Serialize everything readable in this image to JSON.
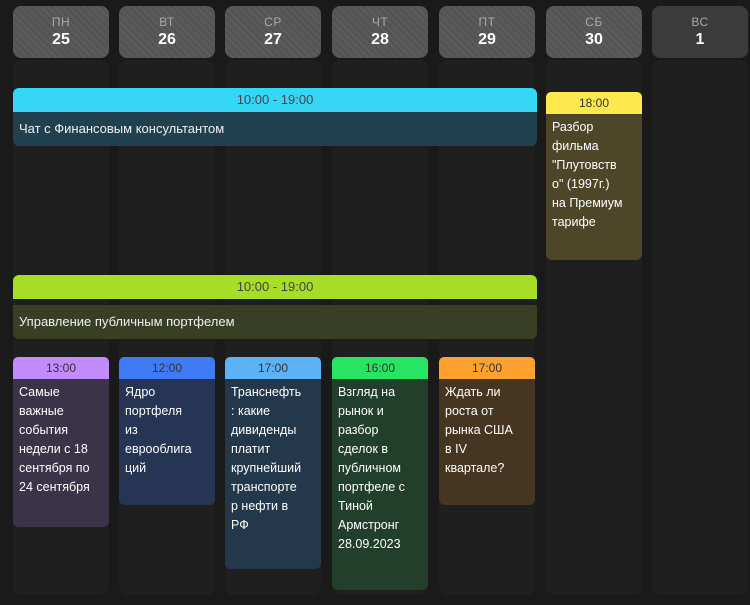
{
  "days": [
    {
      "dow": "ПН",
      "num": "25"
    },
    {
      "dow": "ВТ",
      "num": "26"
    },
    {
      "dow": "СР",
      "num": "27"
    },
    {
      "dow": "ЧТ",
      "num": "28"
    },
    {
      "dow": "ПТ",
      "num": "29"
    },
    {
      "dow": "СБ",
      "num": "30"
    },
    {
      "dow": "ВС",
      "num": "1"
    }
  ],
  "events": {
    "consultant": {
      "time": "10:00 - 19:00",
      "title": "Чат с Финансовым консультантом"
    },
    "portfolio": {
      "time": "10:00 - 19:00",
      "title": "Управление публичным портфелем"
    },
    "film": {
      "time": "18:00",
      "title": "Разбор\nфильма\n\"Плутовств\nо\" (1997г.)\nна Премиум\nтарифе"
    },
    "mon": {
      "time": "13:00",
      "title": "Самые\nважные\nсобытия\nнедели с 18\nсентября по\n24 сентября"
    },
    "tue": {
      "time": "12:00",
      "title": "Ядро\nпортфеля\nиз\nеврооблига\nций"
    },
    "wed": {
      "time": "17:00",
      "title": "Транснефть\n: какие\nдивиденды\nплатит\nкрупнейший\nтранспорте\nр нефти в\nРФ"
    },
    "thu": {
      "time": "16:00",
      "title": "Взгляд на\nрынок и\nразбор\nсделок в\nпубличном\nпортфеле с\nТиной\nАрмстронг\n28.09.2023"
    },
    "fri": {
      "time": "17:00",
      "title": "Ждать ли\nроста от\nрынка США\nв IV\nквартале?"
    }
  },
  "colors": {
    "cyan": "#36d6f7",
    "green": "#a6dd27",
    "yellow": "#fde94d",
    "violet": "#c28cff",
    "blue": "#3f7bf5",
    "sky": "#5cb2f7",
    "lime": "#27e563",
    "orange": "#ffa12e"
  }
}
